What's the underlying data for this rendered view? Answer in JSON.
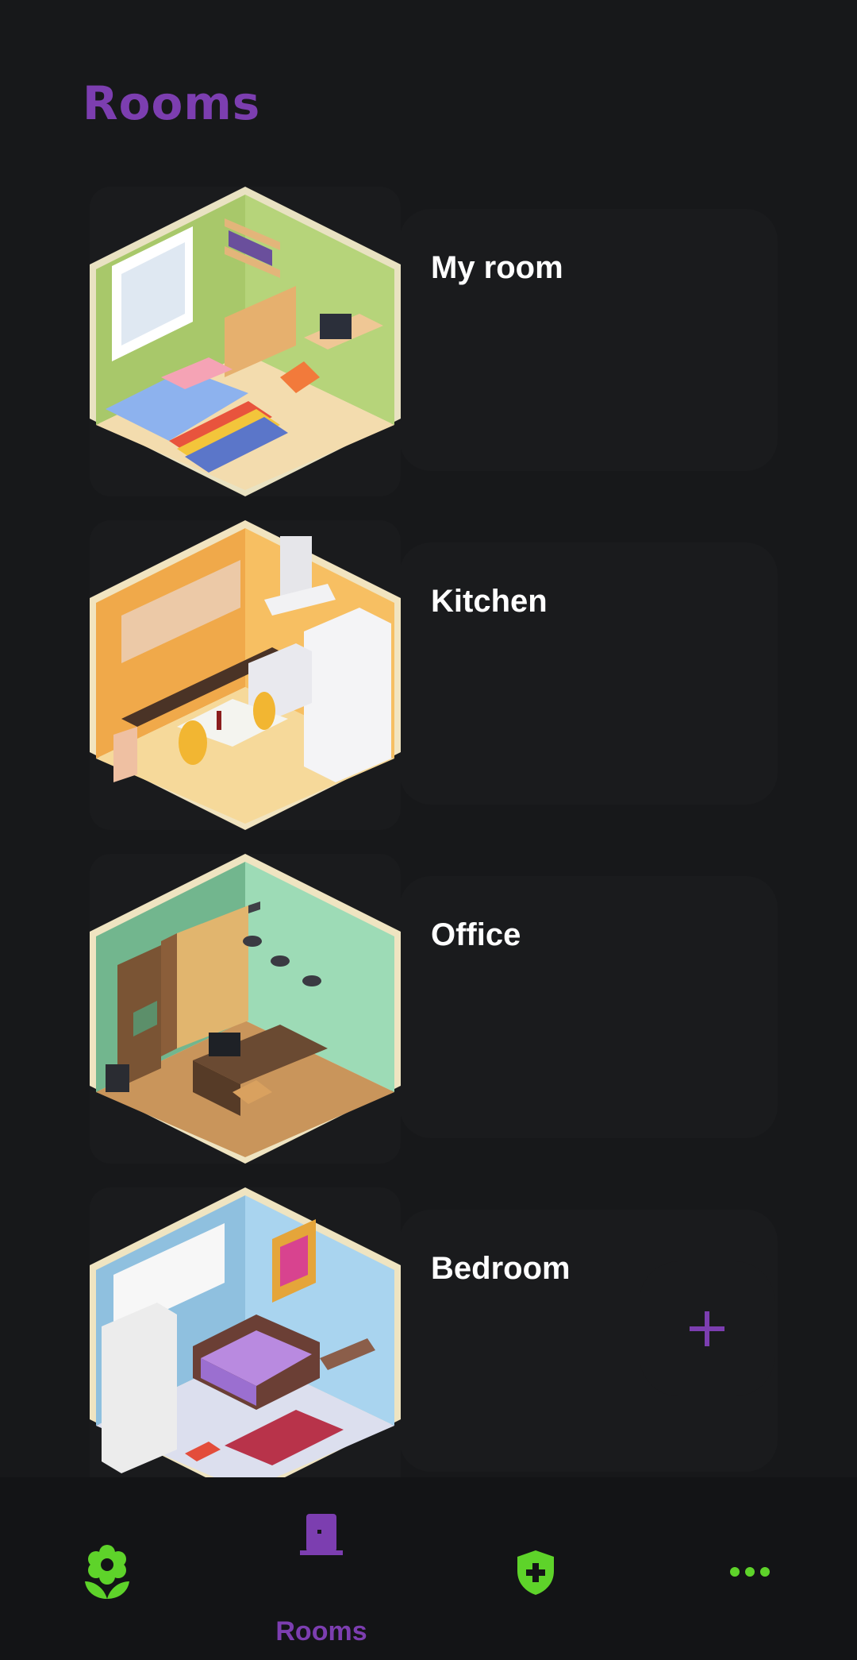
{
  "header": {
    "title": "Rooms"
  },
  "rooms": [
    {
      "name": "My room",
      "scene": "bedroom-green"
    },
    {
      "name": "Kitchen",
      "scene": "kitchen-orange"
    },
    {
      "name": "Office",
      "scene": "office-mint"
    },
    {
      "name": "Bedroom",
      "scene": "bedroom-blue"
    }
  ],
  "fab": {
    "icon": "plus-icon",
    "color": "#7c3eb0"
  },
  "bottom_nav": {
    "items": [
      {
        "icon": "flower-icon",
        "label": "",
        "active": false
      },
      {
        "icon": "door-icon",
        "label": "Rooms",
        "active": true
      },
      {
        "icon": "shield-plus-icon",
        "label": "",
        "active": false
      },
      {
        "icon": "more-dots-icon",
        "label": "",
        "active": false
      }
    ]
  },
  "colors": {
    "background": "#17181a",
    "card": "#1a1b1d",
    "accent_purple": "#7c3eb0",
    "accent_green": "#5ed32a",
    "text": "#ffffff"
  }
}
